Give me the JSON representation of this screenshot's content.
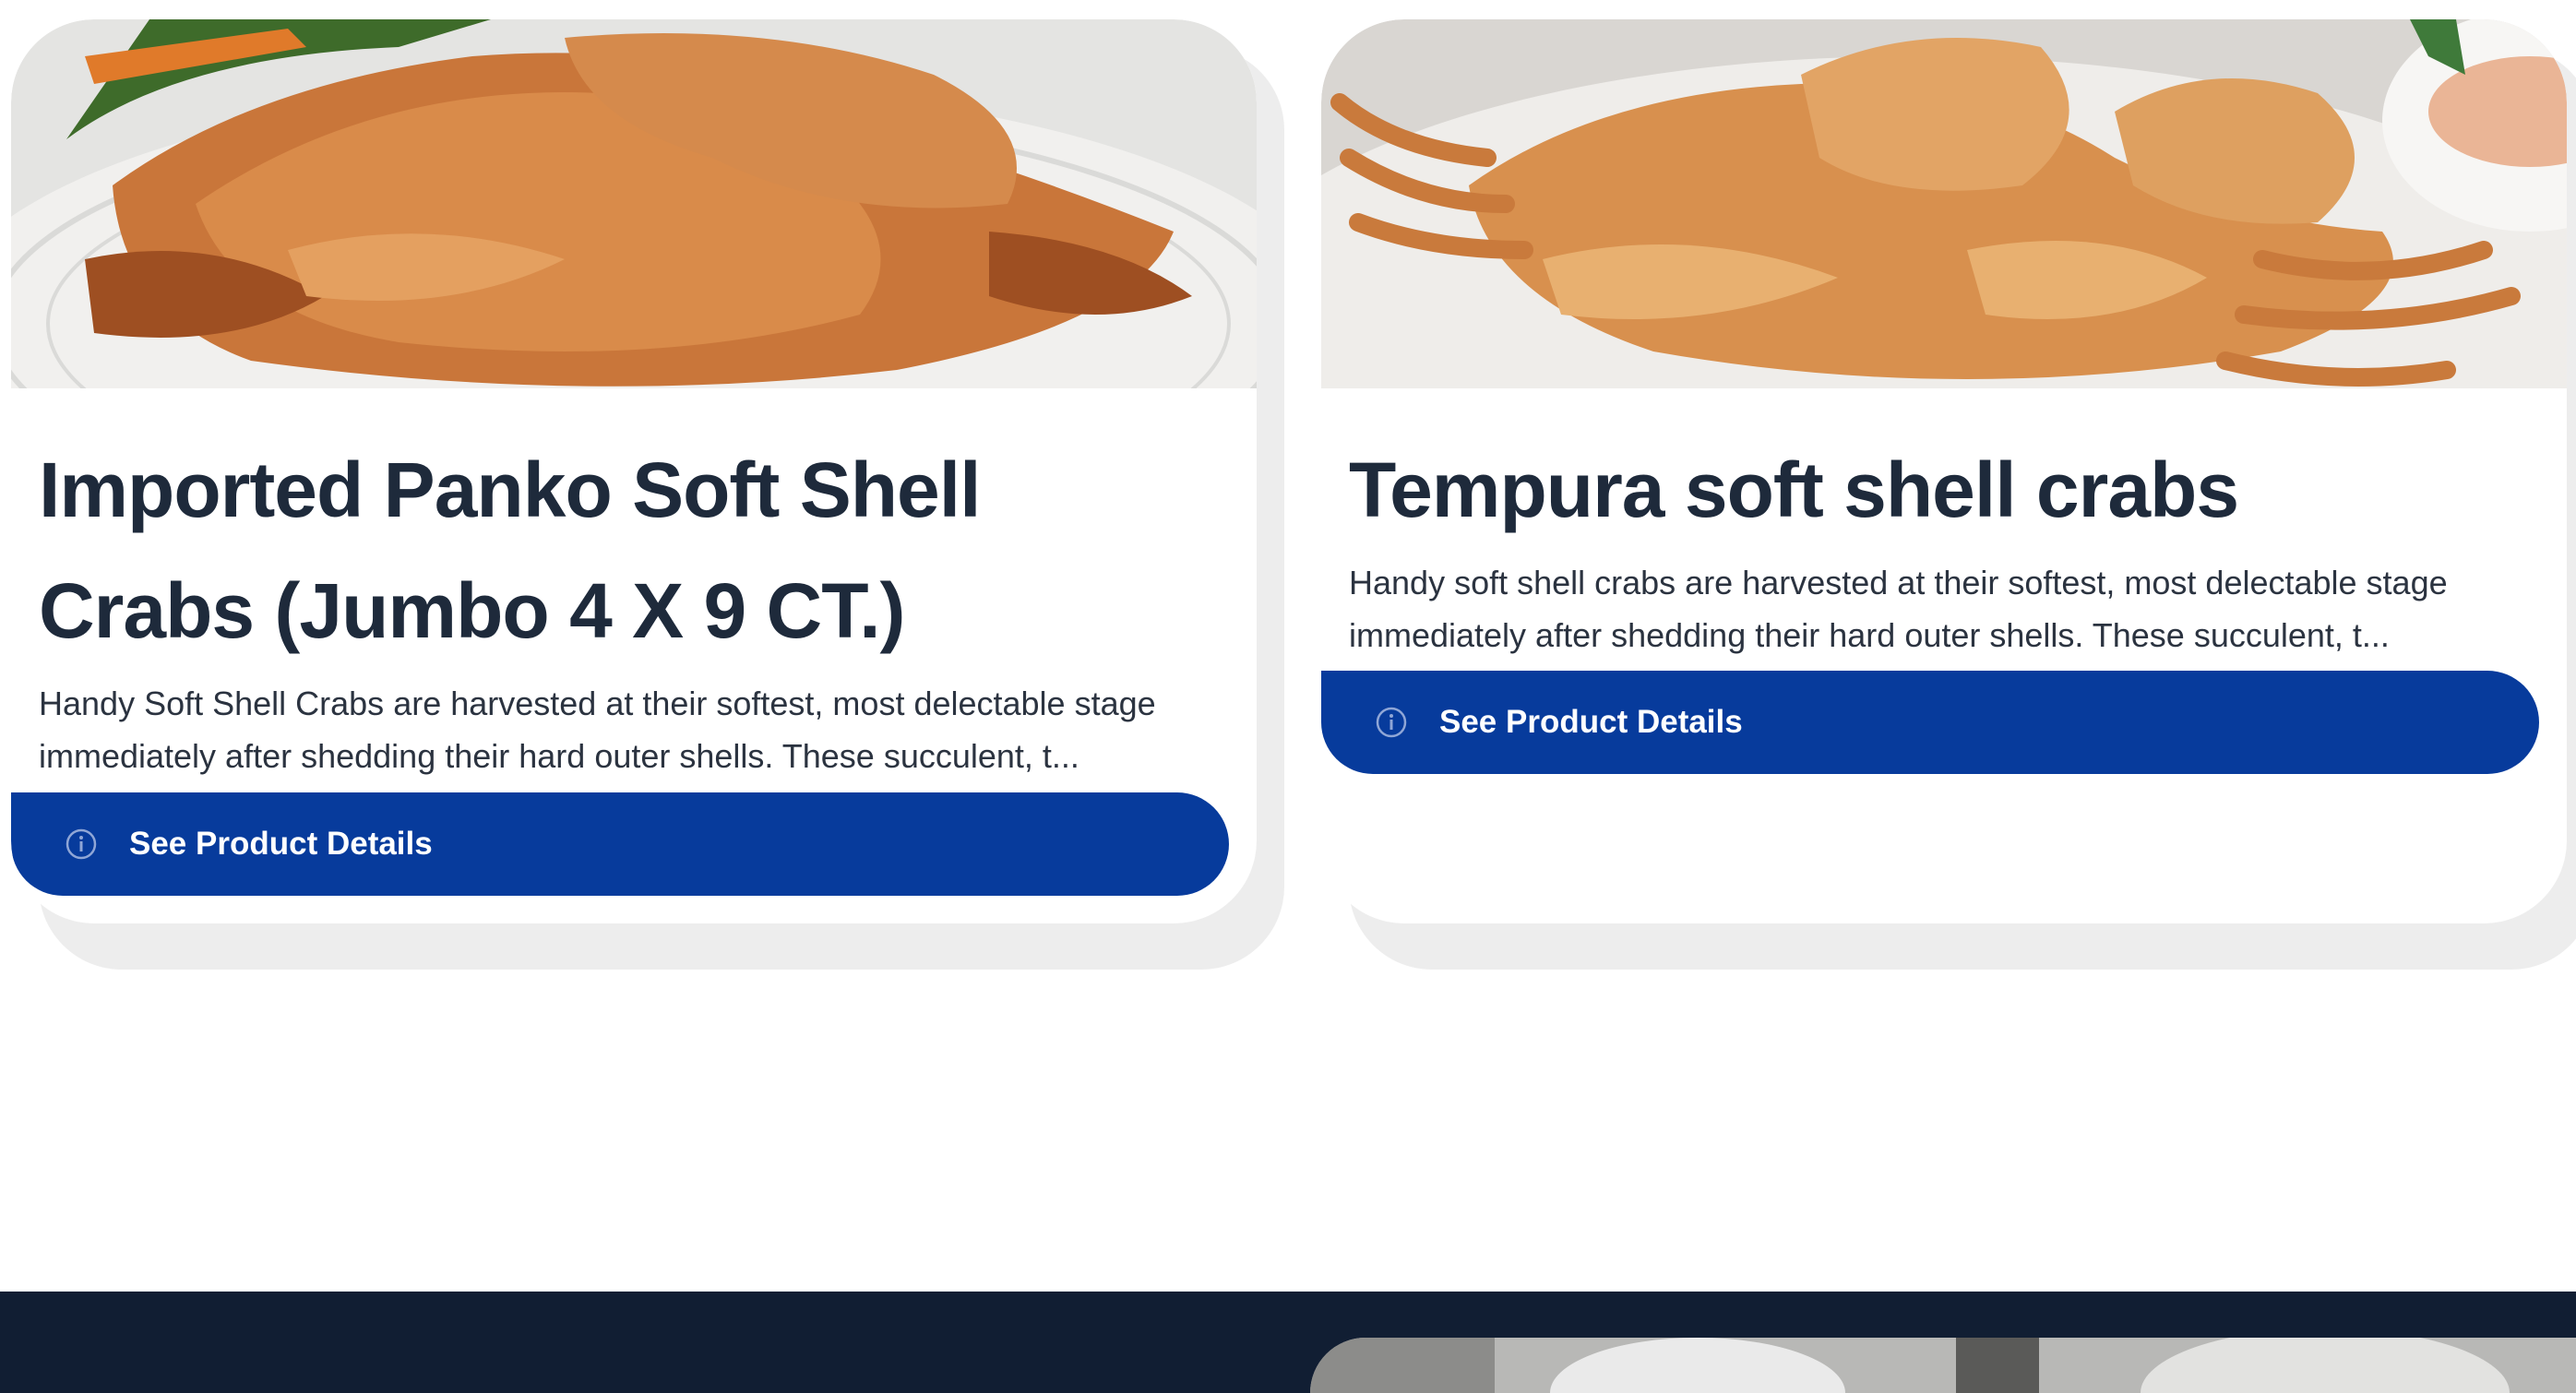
{
  "products": [
    {
      "title": "Imported Panko Soft Shell Crabs (Jumbo 4 X 9 CT.)",
      "description": "Handy Soft Shell Crabs are harvested at their softest, most delectable stage immediately after shedding their hard outer shells. These succulent, t...",
      "button_label": "See Product Details",
      "button_icon": "info-circle-icon",
      "image": "panko-crab-photo"
    },
    {
      "title": "Tempura soft shell crabs",
      "description": "Handy soft shell crabs are harvested at their softest, most delectable stage immediately after shedding their hard outer shells. These succulent, t...",
      "button_label": "See Product Details",
      "button_icon": "info-circle-icon",
      "image": "tempura-crab-photo"
    }
  ],
  "footer": {
    "image": "kitchen-staff-photo"
  },
  "colors": {
    "button_bg": "#073b9c",
    "title_text": "#1e2a3b",
    "footer_bg": "#111e33",
    "card_shadow": "#ededed"
  }
}
